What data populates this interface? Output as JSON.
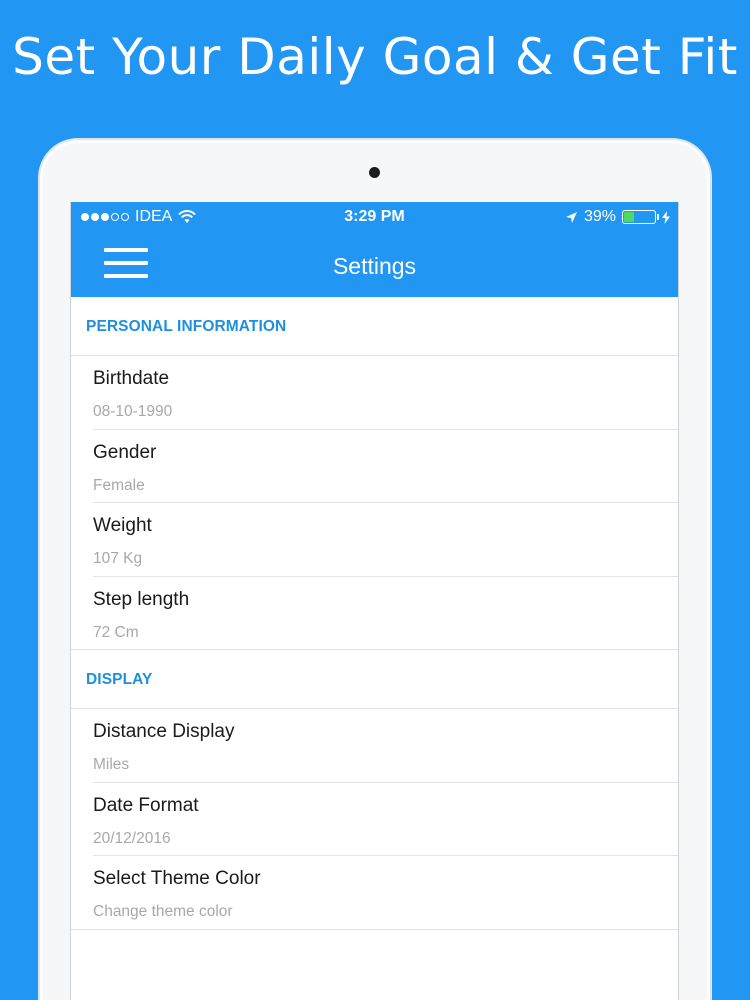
{
  "headline": "Set Your Daily Goal & Get Fit",
  "status_bar": {
    "carrier": "IDEA",
    "time": "3:29 PM",
    "battery": "39%",
    "battery_level": 0.39,
    "icons": [
      "signal-dots-icon",
      "wifi-icon",
      "location-arrow-icon",
      "battery-icon",
      "charging-bolt-icon"
    ]
  },
  "navbar": {
    "title": "Settings",
    "menu_icon": "hamburger-menu-icon"
  },
  "sections": [
    {
      "header": "PERSONAL INFORMATION",
      "rows": [
        {
          "title": "Birthdate",
          "value": "08-10-1990"
        },
        {
          "title": "Gender",
          "value": "Female"
        },
        {
          "title": "Weight",
          "value": "107 Kg"
        },
        {
          "title": "Step length",
          "value": "72 Cm"
        }
      ]
    },
    {
      "header": "DISPLAY",
      "rows": [
        {
          "title": "Distance Display",
          "value": "Miles"
        },
        {
          "title": "Date Format",
          "value": "20/12/2016"
        },
        {
          "title": "Select Theme Color",
          "value": "Change theme color"
        }
      ]
    }
  ],
  "colors": {
    "accent": "#2196f3",
    "section_header": "#1e8fe0",
    "row_value": "#a8a8a8",
    "battery_fill": "#4cd964"
  }
}
